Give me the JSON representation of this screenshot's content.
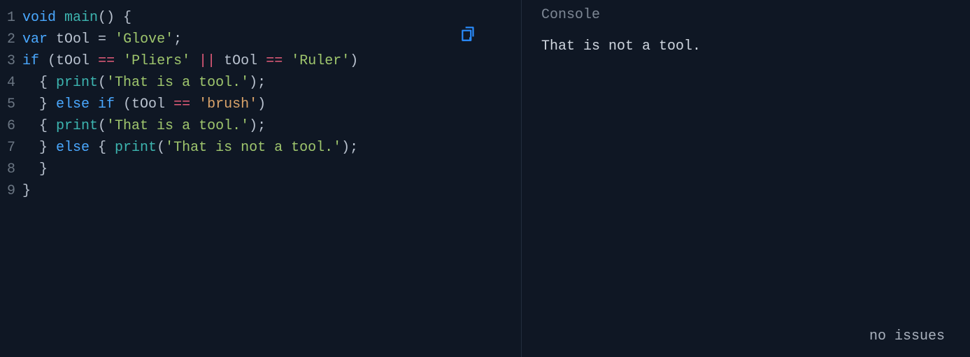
{
  "console": {
    "title": "Console",
    "output": "That is not a tool.",
    "status": "no issues"
  },
  "editor": {
    "copy_icon": "copy-icon",
    "lines": [
      {
        "n": "1",
        "tokens": [
          {
            "cls": "tok-kw",
            "t": "void"
          },
          {
            "cls": "tok-punc",
            "t": " "
          },
          {
            "cls": "tok-fn",
            "t": "main"
          },
          {
            "cls": "tok-punc",
            "t": "() {"
          }
        ]
      },
      {
        "n": "2",
        "tokens": [
          {
            "cls": "tok-kw",
            "t": "var"
          },
          {
            "cls": "tok-punc",
            "t": " "
          },
          {
            "cls": "tok-ident",
            "t": "tOol"
          },
          {
            "cls": "tok-punc",
            "t": " = "
          },
          {
            "cls": "tok-str",
            "t": "'Glove'"
          },
          {
            "cls": "tok-punc",
            "t": ";"
          }
        ]
      },
      {
        "n": "3",
        "tokens": [
          {
            "cls": "tok-kw",
            "t": "if"
          },
          {
            "cls": "tok-punc",
            "t": " ("
          },
          {
            "cls": "tok-ident",
            "t": "tOol"
          },
          {
            "cls": "tok-punc",
            "t": " "
          },
          {
            "cls": "tok-op",
            "t": "=="
          },
          {
            "cls": "tok-punc",
            "t": " "
          },
          {
            "cls": "tok-str",
            "t": "'Pliers'"
          },
          {
            "cls": "tok-punc",
            "t": " "
          },
          {
            "cls": "tok-op",
            "t": "||"
          },
          {
            "cls": "tok-punc",
            "t": " "
          },
          {
            "cls": "tok-ident",
            "t": "tOol"
          },
          {
            "cls": "tok-punc",
            "t": " "
          },
          {
            "cls": "tok-op",
            "t": "=="
          },
          {
            "cls": "tok-punc",
            "t": " "
          },
          {
            "cls": "tok-str",
            "t": "'Ruler'"
          },
          {
            "cls": "tok-punc",
            "t": ")"
          }
        ]
      },
      {
        "n": "4",
        "tokens": [
          {
            "cls": "tok-punc",
            "t": "  { "
          },
          {
            "cls": "tok-fn",
            "t": "print"
          },
          {
            "cls": "tok-punc",
            "t": "("
          },
          {
            "cls": "tok-str",
            "t": "'That is a tool.'"
          },
          {
            "cls": "tok-punc",
            "t": ");"
          }
        ]
      },
      {
        "n": "5",
        "tokens": [
          {
            "cls": "tok-punc",
            "t": "  } "
          },
          {
            "cls": "tok-kw",
            "t": "else if"
          },
          {
            "cls": "tok-punc",
            "t": " ("
          },
          {
            "cls": "tok-ident",
            "t": "tOol"
          },
          {
            "cls": "tok-punc",
            "t": " "
          },
          {
            "cls": "tok-op",
            "t": "=="
          },
          {
            "cls": "tok-punc",
            "t": " "
          },
          {
            "cls": "tok-str2",
            "t": "'brush'"
          },
          {
            "cls": "tok-punc",
            "t": ")"
          }
        ]
      },
      {
        "n": "6",
        "tokens": [
          {
            "cls": "tok-punc",
            "t": "  { "
          },
          {
            "cls": "tok-fn",
            "t": "print"
          },
          {
            "cls": "tok-punc",
            "t": "("
          },
          {
            "cls": "tok-str",
            "t": "'That is a tool.'"
          },
          {
            "cls": "tok-punc",
            "t": ");"
          }
        ]
      },
      {
        "n": "7",
        "tokens": [
          {
            "cls": "tok-punc",
            "t": "  } "
          },
          {
            "cls": "tok-kw",
            "t": "else"
          },
          {
            "cls": "tok-punc",
            "t": " { "
          },
          {
            "cls": "tok-fn",
            "t": "print"
          },
          {
            "cls": "tok-punc",
            "t": "("
          },
          {
            "cls": "tok-str",
            "t": "'That is not a tool.'"
          },
          {
            "cls": "tok-punc",
            "t": ");"
          }
        ]
      },
      {
        "n": "8",
        "tokens": [
          {
            "cls": "tok-punc",
            "t": "  }"
          }
        ]
      },
      {
        "n": "9",
        "tokens": [
          {
            "cls": "tok-punc",
            "t": "}"
          }
        ]
      }
    ]
  }
}
